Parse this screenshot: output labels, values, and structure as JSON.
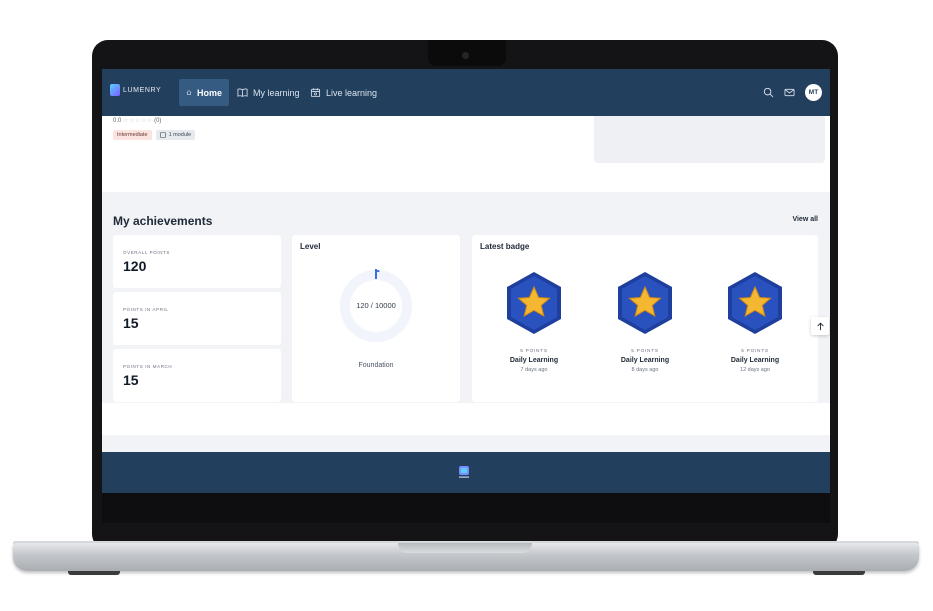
{
  "nav": {
    "brand": "LUMENRY",
    "items": [
      {
        "label": "Home",
        "icon": "home-icon",
        "active": true
      },
      {
        "label": "My learning",
        "icon": "book-icon",
        "active": false
      },
      {
        "label": "Live learning",
        "icon": "calendar-icon",
        "active": false
      }
    ],
    "avatar_initials": "MT"
  },
  "course": {
    "rating_value": "0.0",
    "rating_count": "(0)",
    "level_tag": "Intermediate",
    "modules_tag": "1 module"
  },
  "achievements": {
    "title": "My achievements",
    "view_all": "View all",
    "points": [
      {
        "label": "OVERALL POINTS",
        "value": "120"
      },
      {
        "label": "POINTS IN APRIL",
        "value": "15"
      },
      {
        "label": "POINTS IN MARCH",
        "value": "15"
      }
    ],
    "level": {
      "title": "Level",
      "progress_text": "120 / 10000",
      "current": 120,
      "max": 10000,
      "name": "Foundation"
    },
    "latest_badge": {
      "title": "Latest badge",
      "badges": [
        {
          "points": "5 POINTS",
          "name": "Daily Learning",
          "date": "7 days ago"
        },
        {
          "points": "5 POINTS",
          "name": "Daily Learning",
          "date": "8 days ago"
        },
        {
          "points": "5 POINTS",
          "name": "Daily Learning",
          "date": "12 days ago"
        }
      ]
    }
  },
  "colors": {
    "nav_bg": "#223f5e",
    "nav_active": "#355b82",
    "badge_hex": "#1e3f9e",
    "badge_star": "#f4b731",
    "progress": "#3b6fe0"
  }
}
